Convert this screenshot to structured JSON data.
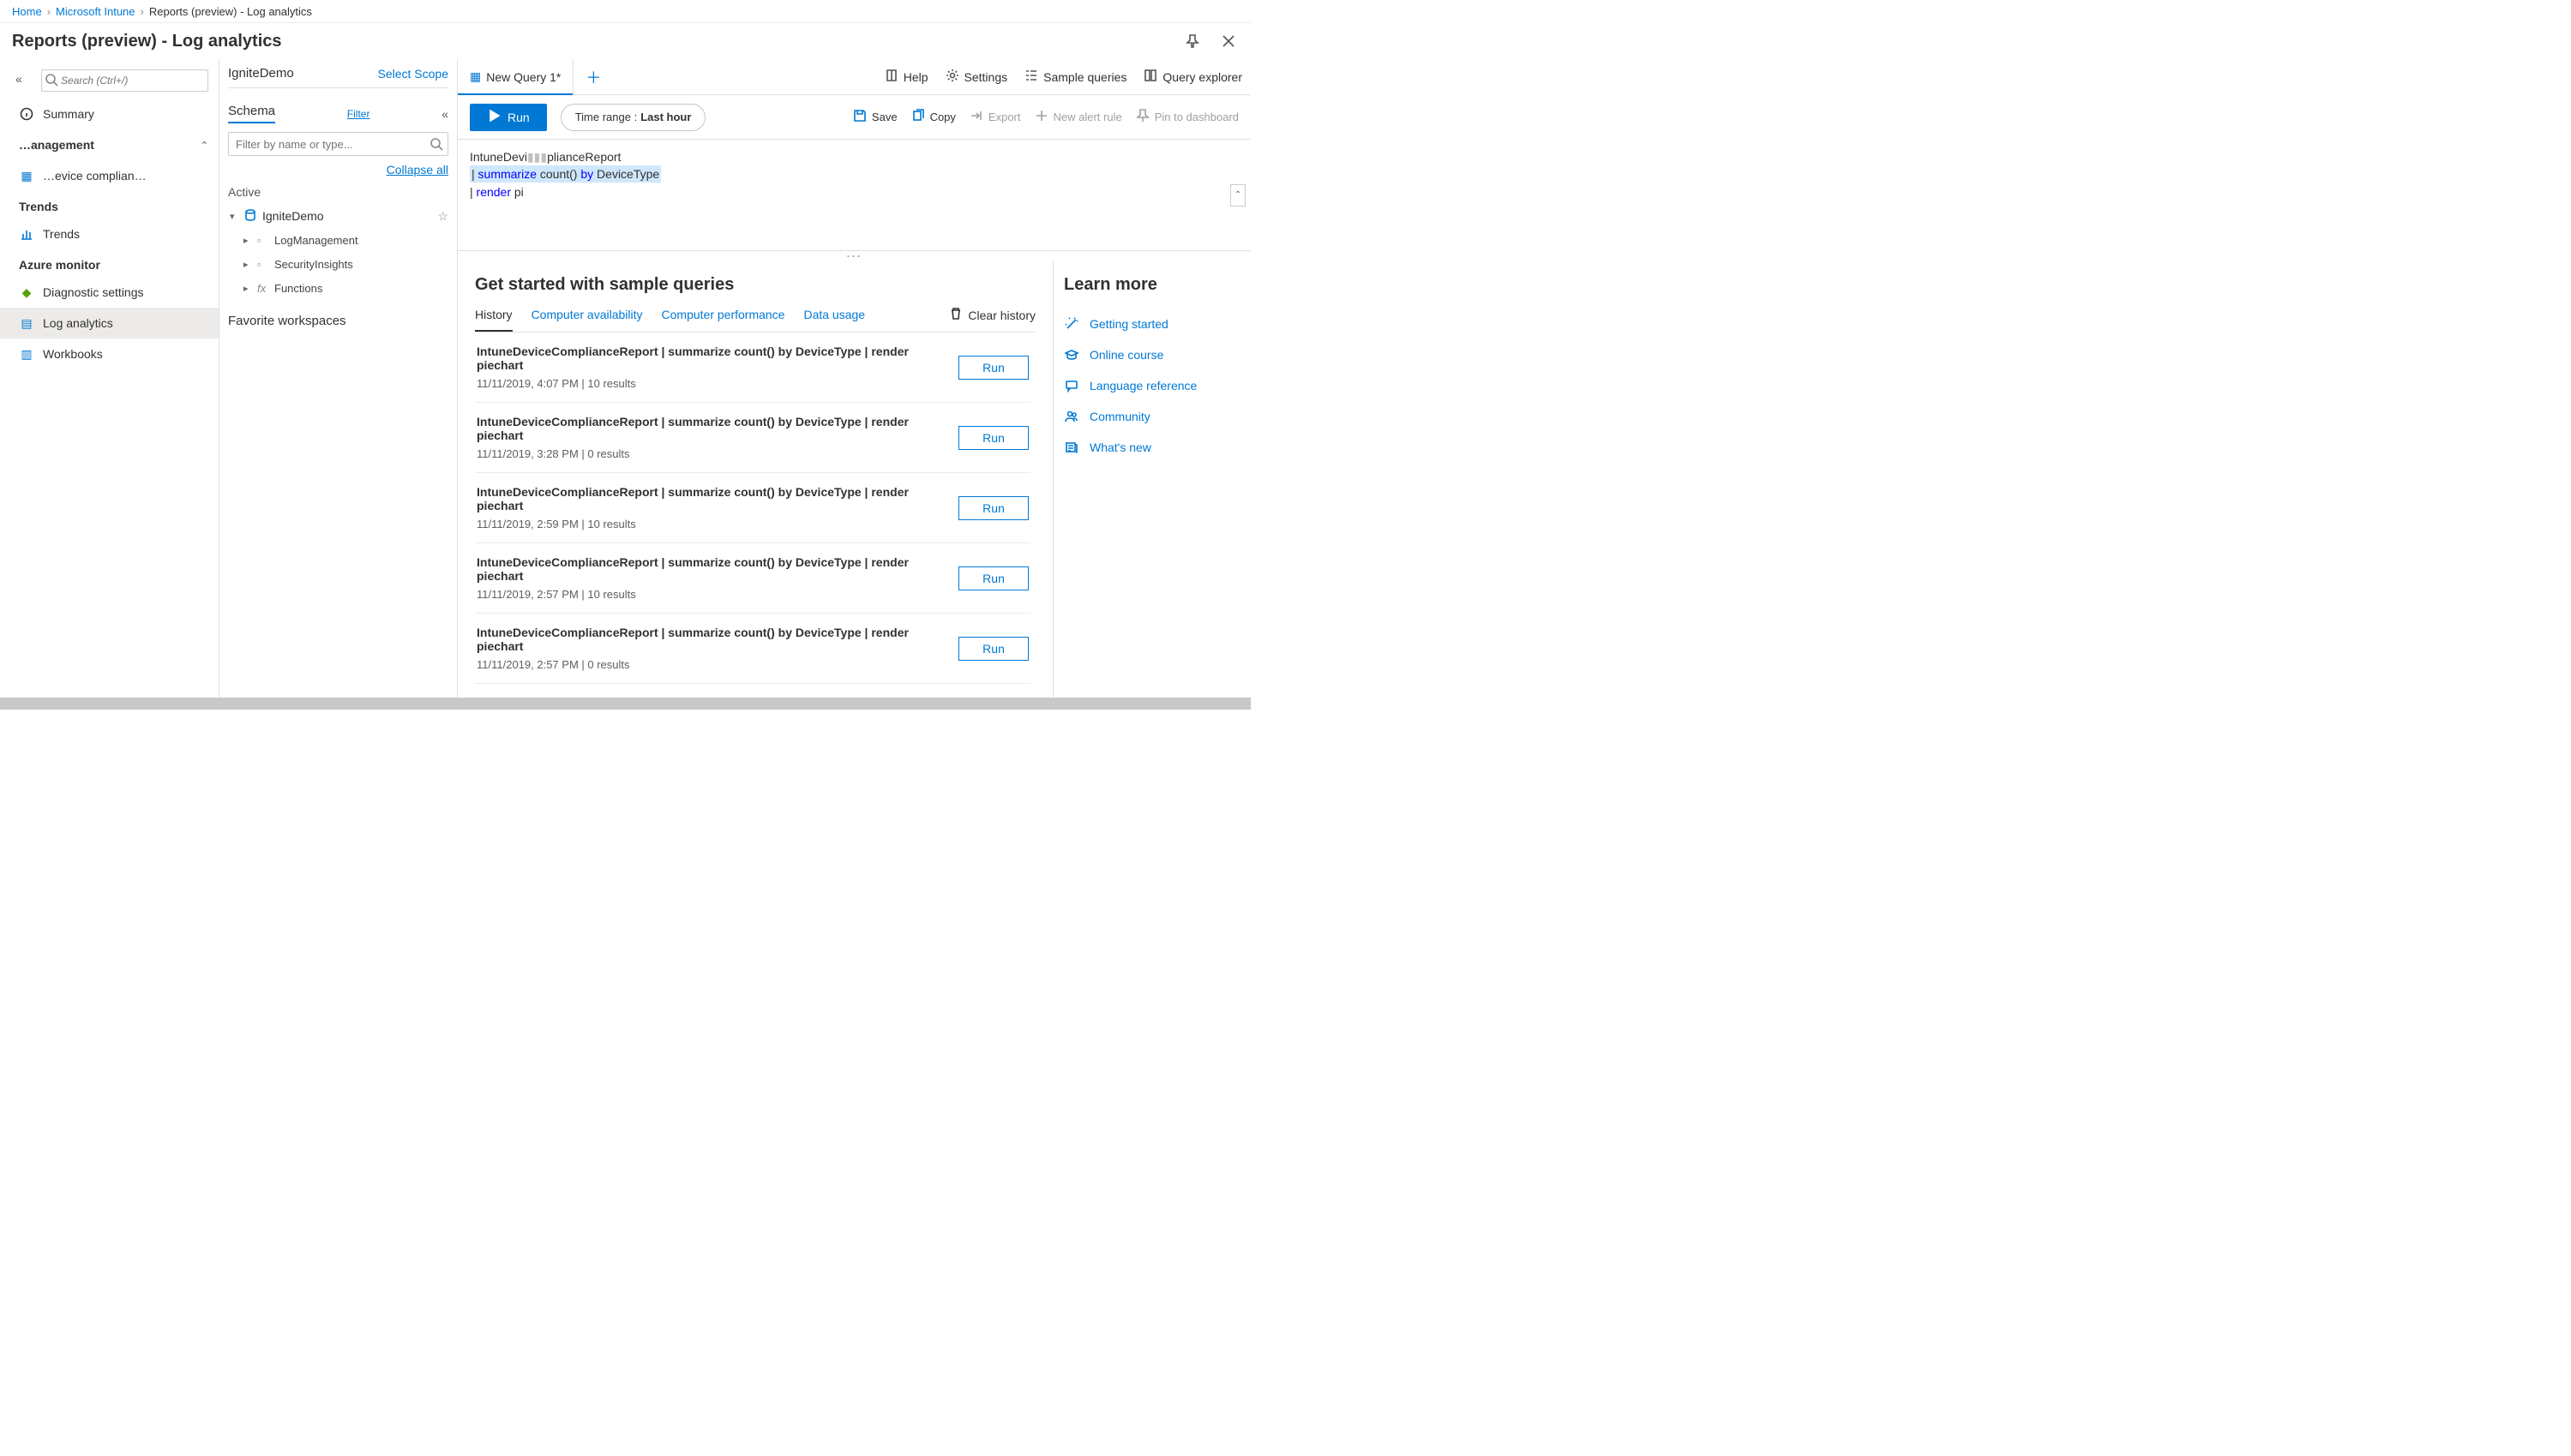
{
  "breadcrumbs": [
    {
      "label": "Home",
      "link": true
    },
    {
      "label": "Microsoft Intune",
      "link": true
    },
    {
      "label": "Reports (preview) - Log analytics",
      "link": false
    }
  ],
  "title": "Reports (preview) - Log analytics",
  "search_placeholder": "Search (Ctrl+/)",
  "leftnav": {
    "summary": {
      "label": "Summary"
    },
    "management": {
      "header": "…anagement",
      "items": [
        {
          "label": "…evice complian…",
          "icon": "clipboard"
        }
      ]
    },
    "trends": {
      "header": "Trends",
      "items": [
        {
          "label": "Trends",
          "icon": "chart"
        }
      ]
    },
    "azure": {
      "header": "Azure monitor",
      "items": [
        {
          "label": "Diagnostic settings",
          "icon": "diag"
        },
        {
          "label": "Log analytics",
          "icon": "log",
          "active": true
        },
        {
          "label": "Workbooks",
          "icon": "book"
        }
      ]
    }
  },
  "schema": {
    "selected": "IgniteDemo",
    "select_scope": "Select Scope",
    "tab": "Schema",
    "filter_text": "Filter",
    "collapse_btn": "«",
    "filter_placeholder": "Filter by name or type...",
    "collapse_all": "Collapse all",
    "active": "Active",
    "workspace": "IgniteDemo",
    "children": [
      {
        "label": "LogManagement",
        "icon": "cube"
      },
      {
        "label": "SecurityInsights",
        "icon": "cube"
      },
      {
        "label": "Functions",
        "icon": "fx"
      }
    ],
    "favorites": "Favorite workspaces"
  },
  "tabs": {
    "query1": "New Query 1*"
  },
  "toolbar": {
    "help": "Help",
    "settings": "Settings",
    "sample": "Sample queries",
    "explorer": "Query explorer"
  },
  "runbar": {
    "run": "Run",
    "timerange_prefix": "Time range : ",
    "timerange_value": "Last hour",
    "save": "Save",
    "copy": "Copy",
    "export": "Export",
    "new_alert": "New alert rule",
    "pin": "Pin to dashboard"
  },
  "editor": {
    "line1_a": "IntuneDevi",
    "line1_b": "plianceReport",
    "line2_a": "| ",
    "line2_kw": "summarize",
    "line2_b": " count() ",
    "line2_kw2": "by",
    "line2_c": " DeviceType",
    "line3_a": "| ",
    "line3_kw": "render",
    "line3_b": " pi",
    "line3_c": "    "
  },
  "results": {
    "heading": "Get started with sample queries",
    "tabs": [
      {
        "label": "History"
      },
      {
        "label": "Computer availability"
      },
      {
        "label": "Computer performance"
      },
      {
        "label": "Data usage"
      }
    ],
    "clear": "Clear history",
    "history": [
      {
        "q": "IntuneDeviceComplianceReport | summarize count() by DeviceType | render piechart",
        "meta": "11/11/2019, 4:07 PM | 10 results"
      },
      {
        "q": "IntuneDeviceComplianceReport | summarize count() by DeviceType | render piechart",
        "meta": "11/11/2019, 3:28 PM | 0 results"
      },
      {
        "q": "IntuneDeviceComplianceReport | summarize count() by DeviceType | render piechart",
        "meta": "11/11/2019, 2:59 PM | 10 results"
      },
      {
        "q": "IntuneDeviceComplianceReport | summarize count() by DeviceType | render piechart",
        "meta": "11/11/2019, 2:57 PM | 10 results"
      },
      {
        "q": "IntuneDeviceComplianceReport | summarize count() by DeviceType | render piechart",
        "meta": "11/11/2019, 2:57 PM | 0 results"
      }
    ],
    "run": "Run"
  },
  "learn": {
    "heading": "Learn more",
    "items": [
      {
        "label": "Getting started",
        "icon": "wand"
      },
      {
        "label": "Online course",
        "icon": "grad"
      },
      {
        "label": "Language reference",
        "icon": "chat"
      },
      {
        "label": "Community",
        "icon": "people"
      },
      {
        "label": "What's new",
        "icon": "news"
      }
    ]
  }
}
